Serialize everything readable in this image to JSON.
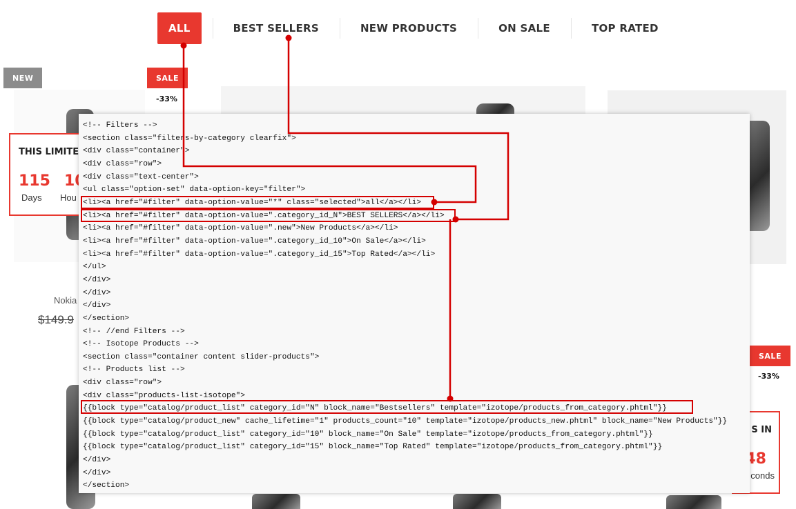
{
  "tabs": [
    {
      "label": "ALL",
      "active": true
    },
    {
      "label": "BEST SELLERS",
      "active": false
    },
    {
      "label": "NEW PRODUCTS",
      "active": false
    },
    {
      "label": "ON SALE",
      "active": false
    },
    {
      "label": "TOP RATED",
      "active": false
    }
  ],
  "badges": {
    "new": "NEW",
    "sale": "SALE",
    "discount": "-33%"
  },
  "countdown_left": {
    "title": "THIS LIMITE",
    "days_value": "115",
    "days_label": "Days",
    "hours_value": "10",
    "hours_label": "Hou"
  },
  "countdown_right": {
    "title": "S IN",
    "value": "48",
    "label": "conds"
  },
  "product": {
    "name": "Nokia",
    "price": "$149.9"
  },
  "code_lines": [
    "<!-- Filters -->",
    "<section class=\"filters-by-category clearfix\">",
    "<div class=\"container\">",
    "<div class=\"row\">",
    "<div class=\"text-center\">",
    "<ul class=\"option-set\" data-option-key=\"filter\">",
    "<li><a href=\"#filter\" data-option-value=\"*\" class=\"selected\">all</a></li>",
    "<li><a href=\"#filter\" data-option-value=\".category_id_N\">BEST SELLERS</a></li>",
    "<li><a href=\"#filter\" data-option-value=\".new\">New Products</a></li>",
    "<li><a href=\"#filter\" data-option-value=\".category_id_10\">On Sale</a></li>",
    "<li><a href=\"#filter\" data-option-value=\".category_id_15\">Top Rated</a></li>",
    "</ul>",
    "</div>",
    "</div>",
    "</div>",
    "</section>",
    "<!-- //end Filters -->",
    "<!-- Isotope Products -->",
    "<section class=\"container content slider-products\">",
    "<!-- Products list -->",
    "<div class=\"row\">",
    "<div class=\"products-list-isotope\">",
    "{{block type=\"catalog/product_list\" category_id=\"N\" block_name=\"Bestsellers\" template=\"izotope/products_from_category.phtml\"}}",
    "{{block type=\"catalog/product_new\" cache_lifetime=\"1\" products_count=\"10\" template=\"izotope/products_new.phtml\" block_name=\"New Products\"}}",
    "{{block type=\"catalog/product_list\" category_id=\"10\" block_name=\"On Sale\" template=\"izotope/products_from_category.phtml\"}}",
    "{{block type=\"catalog/product_list\" category_id=\"15\" block_name=\"Top Rated\" template=\"izotope/products_from_category.phtml\"}}",
    "</div>",
    "</div>",
    "</section>"
  ],
  "colors": {
    "accent": "#e8382f",
    "annotation": "#d40000"
  }
}
